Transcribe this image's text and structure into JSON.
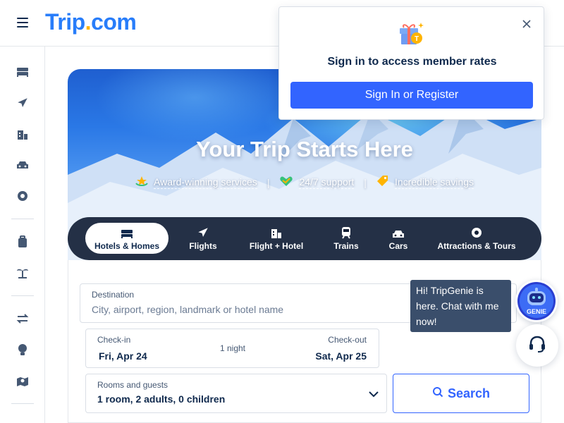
{
  "header": {
    "logo_main": "Trip",
    "logo_dot": ".",
    "logo_tld": "com"
  },
  "sidebar": {
    "items": [
      {
        "icon": "bed-icon",
        "label": "Hotels"
      },
      {
        "icon": "plane-icon",
        "label": "Flights"
      },
      {
        "icon": "flight-hotel-icon",
        "label": "Flight + Hotel"
      },
      {
        "icon": "car-icon",
        "label": "Cars"
      },
      {
        "icon": "attractions-icon",
        "label": "Attractions"
      },
      {
        "icon": "luggage-icon",
        "label": "Trips"
      },
      {
        "icon": "island-icon",
        "label": "Destinations"
      },
      {
        "icon": "exchange-icon",
        "label": "Deals"
      },
      {
        "icon": "lightbulb-icon",
        "label": "Inspiration"
      },
      {
        "icon": "map-pin-icon",
        "label": "Map"
      }
    ]
  },
  "hero": {
    "title": "Your Trip Starts Here",
    "features": [
      {
        "icon": "award-icon",
        "text": "Award-winning services"
      },
      {
        "icon": "heart-support-icon",
        "text": "24/7 support"
      },
      {
        "icon": "tag-icon",
        "text": "Incredible savings"
      }
    ],
    "feature_separator": "|"
  },
  "tabs": [
    {
      "label": "Hotels & Homes",
      "active": true
    },
    {
      "label": "Flights",
      "active": false
    },
    {
      "label": "Flight + Hotel",
      "active": false
    },
    {
      "label": "Trains",
      "active": false
    },
    {
      "label": "Cars",
      "active": false
    },
    {
      "label": "Attractions & Tours",
      "active": false
    }
  ],
  "search": {
    "destination_label": "Destination",
    "destination_placeholder": "City, airport, region, landmark or hotel name",
    "destination_value": "",
    "checkin_label": "Check-in",
    "checkin_value": "Fri, Apr 24",
    "nights": "1 night",
    "checkout_label": "Check-out",
    "checkout_value": "Sat, Apr 25",
    "guests_label": "Rooms and guests",
    "guests_value": "1 room, 2 adults, 0 children",
    "search_button": "Search"
  },
  "signin_popover": {
    "title": "Sign in to access member rates",
    "button": "Sign In or Register"
  },
  "genie": {
    "tooltip": "Hi! TripGenie is here. Chat with me now!",
    "badge": "GENIE"
  },
  "colors": {
    "brand": "#287dfa",
    "primary_button": "#3264ff",
    "logo_dot": "#ffb400",
    "text_dark": "#0f294d",
    "tabs_bar": "#142036"
  }
}
